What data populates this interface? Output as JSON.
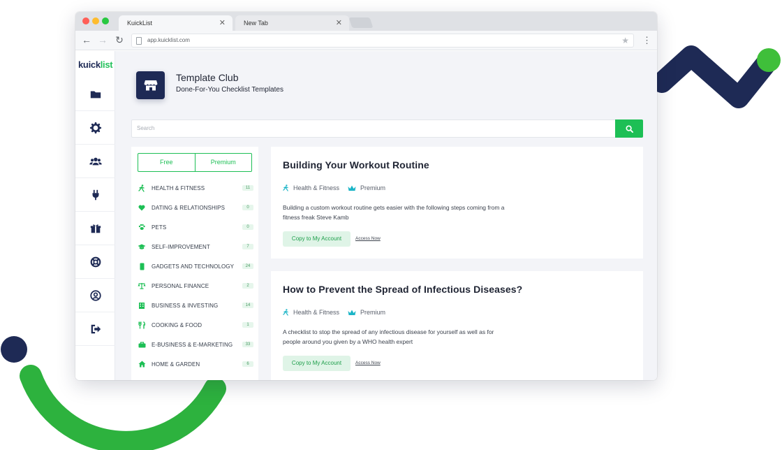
{
  "browser": {
    "tabs": [
      {
        "label": "KuickList",
        "active": true
      },
      {
        "label": "New Tab",
        "active": false
      }
    ],
    "url": "app.kuicklist.com",
    "traffic_colors": [
      "#ff5f57",
      "#febc2e",
      "#28c840"
    ]
  },
  "logo": {
    "part1": "kuick",
    "part2": "list"
  },
  "sidebar": {
    "items": [
      {
        "icon": "folder-icon"
      },
      {
        "icon": "gear-icon"
      },
      {
        "icon": "users-icon"
      },
      {
        "icon": "plug-icon"
      },
      {
        "icon": "gift-icon"
      },
      {
        "icon": "lifebuoy-icon"
      },
      {
        "icon": "user-circle-icon"
      },
      {
        "icon": "logout-icon"
      }
    ]
  },
  "header": {
    "title": "Template Club",
    "subtitle": "Done-For-You Checklist Templates",
    "icon": "store-icon"
  },
  "search": {
    "placeholder": "Search"
  },
  "filter": {
    "free": "Free",
    "premium": "Premium"
  },
  "categories": [
    {
      "label": "HEALTH & FITNESS",
      "count": "11",
      "icon": "running-icon"
    },
    {
      "label": "DATING & RELATIONSHIPS",
      "count": "0",
      "icon": "heart-icon"
    },
    {
      "label": "PETS",
      "count": "0",
      "icon": "paw-icon"
    },
    {
      "label": "SELF-IMPROVEMENT",
      "count": "7",
      "icon": "graduation-cap-icon"
    },
    {
      "label": "GADGETS AND TECHNOLOGY",
      "count": "24",
      "icon": "mobile-icon"
    },
    {
      "label": "PERSONAL FINANCE",
      "count": "2",
      "icon": "scale-icon"
    },
    {
      "label": "BUSINESS & INVESTING",
      "count": "14",
      "icon": "building-icon"
    },
    {
      "label": "COOKING & FOOD",
      "count": "1",
      "icon": "utensils-icon"
    },
    {
      "label": "E-BUSINESS & E-MARKETING",
      "count": "33",
      "icon": "briefcase-icon"
    },
    {
      "label": "HOME & GARDEN",
      "count": "6",
      "icon": "home-icon"
    }
  ],
  "cards": [
    {
      "title": "Building Your Workout Routine",
      "category": "Health & Fitness",
      "tier": "Premium",
      "description": "Building a custom workout routine gets easier with the following steps coming from a fitness freak Steve Kamb",
      "copy_label": "Copy to My Account",
      "access_label": "Access Now"
    },
    {
      "title": "How to Prevent the Spread of Infectious Diseases?",
      "category": "Health & Fitness",
      "tier": "Premium",
      "description": "A checklist to stop the spread of any infectious disease for yourself as well as for people around you given by a WHO health expert",
      "copy_label": "Copy to My Account",
      "access_label": "Access Now"
    }
  ],
  "colors": {
    "accent": "#1dbf55",
    "navy": "#1e2a55",
    "premium": "#1cb5c7"
  }
}
